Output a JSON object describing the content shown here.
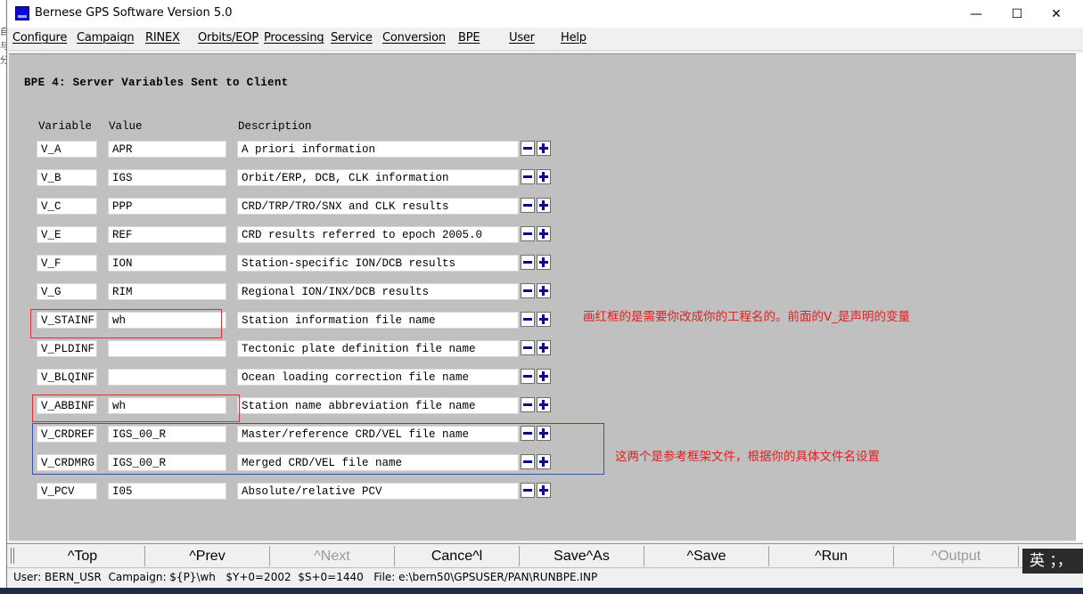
{
  "window": {
    "title": "Bernese GPS Software Version 5.0",
    "minimize": "—",
    "maximize": "☐",
    "close": "✕"
  },
  "menu": [
    "Configure",
    "Campaign",
    "RINEX",
    "Orbits/EOP",
    "Processing",
    "Service",
    "Conversion",
    "BPE",
    "User",
    "Help"
  ],
  "panel": {
    "heading": "BPE 4: Server Variables Sent to Client",
    "columns": {
      "variable": "Variable",
      "value": "Value",
      "description": "Description"
    },
    "rows": [
      {
        "variable": "V_A",
        "value": "APR",
        "description": "A priori information"
      },
      {
        "variable": "V_B",
        "value": "IGS",
        "description": "Orbit/ERP, DCB, CLK information"
      },
      {
        "variable": "V_C",
        "value": "PPP",
        "description": "CRD/TRP/TRO/SNX and CLK results"
      },
      {
        "variable": "V_E",
        "value": "REF",
        "description": "CRD results referred to epoch 2005.0"
      },
      {
        "variable": "V_F",
        "value": "ION",
        "description": "Station-specific ION/DCB results"
      },
      {
        "variable": "V_G",
        "value": "RIM",
        "description": "Regional ION/INX/DCB results"
      },
      {
        "variable": "V_STAINF",
        "value": "wh",
        "description": "Station information file name"
      },
      {
        "variable": "V_PLDINF",
        "value": "",
        "description": "Tectonic plate definition file name"
      },
      {
        "variable": "V_BLQINF",
        "value": "",
        "description": "Ocean loading correction file name"
      },
      {
        "variable": "V_ABBINF",
        "value": "wh",
        "description": "Station name abbreviation file name"
      },
      {
        "variable": "V_CRDREF",
        "value": "IGS_00_R",
        "description": "Master/reference CRD/VEL file name"
      },
      {
        "variable": "V_CRDMRG",
        "value": "IGS_00_R",
        "description": "Merged CRD/VEL file name"
      },
      {
        "variable": "V_PCV",
        "value": "I05",
        "description": "Absolute/relative PCV"
      }
    ],
    "annotations": {
      "red_note": "画红框的是需要你改成你的工程名的。前面的V_是声明的变量",
      "blue_note": "这两个是参考框架文件，根据你的具体文件名设置"
    }
  },
  "buttons": [
    {
      "label": "^Top",
      "enabled": true
    },
    {
      "label": "^Prev",
      "enabled": true
    },
    {
      "label": "^Next",
      "enabled": false
    },
    {
      "label": "Cance^l",
      "enabled": true
    },
    {
      "label": "Save^As",
      "enabled": true
    },
    {
      "label": "^Save",
      "enabled": true
    },
    {
      "label": "^Run",
      "enabled": true
    },
    {
      "label": "^Output",
      "enabled": false
    }
  ],
  "status": "User: BERN_USR  Campaign: ${P}\\wh   $Y+0=2002  $S+0=1440   File: e:\\bern50\\GPSUSER/PAN\\RUNBPE.INP",
  "ime": "英 ；，",
  "colors": {
    "panel_bg": "#c0c0c0",
    "annotation_red": "#e02020",
    "annotation_blue": "#3a4fb0",
    "icon_blue": "#0a0a8a"
  }
}
